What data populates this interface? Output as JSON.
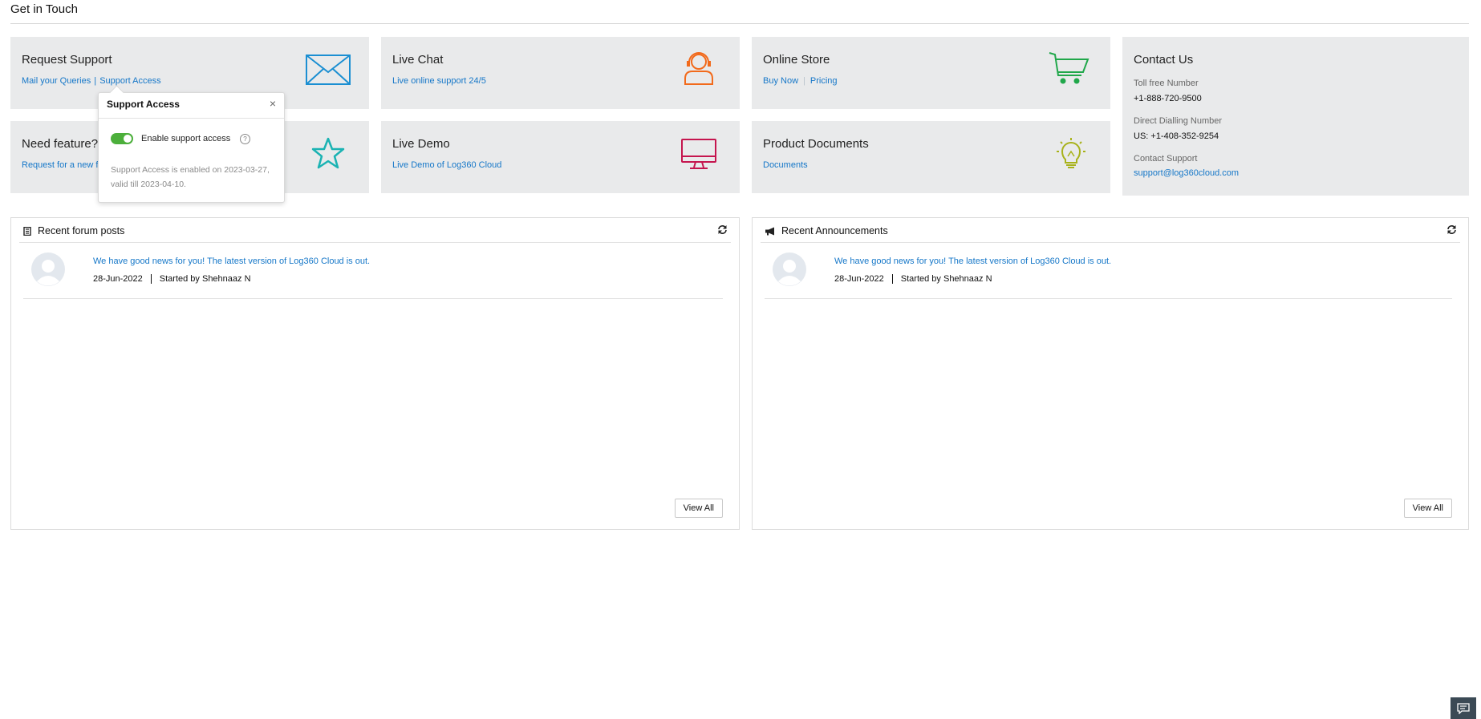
{
  "page": {
    "title": "Get in Touch"
  },
  "cards": {
    "request_support": {
      "title": "Request Support",
      "link1": "Mail your Queries",
      "sep": "|",
      "link2": "Support Access",
      "icon": "envelope-icon",
      "color": "#1b8fd2"
    },
    "live_chat": {
      "title": "Live Chat",
      "link1": "Live online support 24/5",
      "icon": "headset-agent-icon",
      "color": "#f26a1b"
    },
    "online_store": {
      "title": "Online Store",
      "link1": "Buy Now",
      "link2": "Pricing",
      "icon": "cart-icon",
      "color": "#20a74a"
    },
    "need_feature": {
      "title": "Need feature?",
      "link1": "Request for a new feature",
      "icon": "star-icon",
      "color": "#1bb3b3"
    },
    "live_demo": {
      "title": "Live Demo",
      "link1": "Live Demo of Log360 Cloud",
      "icon": "monitor-icon",
      "color": "#c5154e"
    },
    "product_docs": {
      "title": "Product Documents",
      "link1": "Documents",
      "icon": "lightbulb-icon",
      "color": "#a8b21a"
    },
    "contact_us": {
      "title": "Contact Us",
      "toll_free_label": "Toll free Number",
      "toll_free": "+1-888-720-9500",
      "direct_label": "Direct Dialling Number",
      "direct": "US: +1-408-352-9254",
      "support_label": "Contact Support",
      "support_email": "support@log360cloud.com"
    }
  },
  "popover": {
    "title": "Support Access",
    "close": "×",
    "toggle_label": "Enable support access",
    "toggle_on": true,
    "help": "?",
    "note": "Support Access is enabled on 2023-03-27, valid till 2023-04-10."
  },
  "forum": {
    "title": "Recent forum posts",
    "post_title": "We have good news for you! The latest version of Log360 Cloud is out.",
    "date": "28-Jun-2022",
    "author": "Started by Shehnaaz N",
    "view_all": "View All"
  },
  "announcements": {
    "title": "Recent Announcements",
    "post_title": "We have good news for you! The latest version of Log360 Cloud is out.",
    "date": "28-Jun-2022",
    "author": "Started by Shehnaaz N",
    "view_all": "View All"
  }
}
